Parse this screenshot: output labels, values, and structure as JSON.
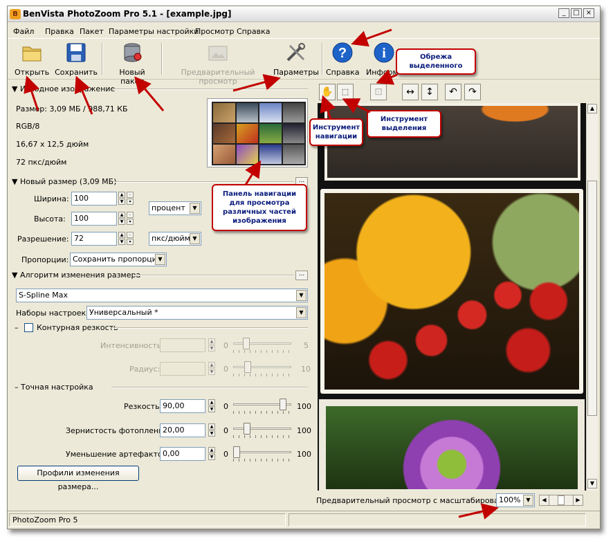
{
  "window": {
    "title": "BenVista PhotoZoom Pro 5.1 - [example.jpg]",
    "app_icon": "bz-logo-icon",
    "min": "_",
    "max": "□",
    "close": "×"
  },
  "menu": [
    "Файл",
    "Правка",
    "Пакет",
    "Параметры настройки",
    "Просмотр",
    "Справка"
  ],
  "toolbar": {
    "open": "Открыть",
    "save": "Сохранить",
    "batch": "Новый пакет",
    "preview": "Предварительный просмотр",
    "params": "Параметры",
    "help": "Справка",
    "info": "Информа"
  },
  "source": {
    "header": "Исходное изображение",
    "size": "Размер: 3,09 МБ / 988,71 КБ",
    "mode": "RGB/8",
    "dims": "16,67 x 12,5 дюйм",
    "dpi": "72 пкс/дюйм"
  },
  "newsize": {
    "header": "Новый размер (3,09 МБ)",
    "width_label": "Ширина:",
    "width": "100",
    "height_label": "Высота:",
    "height": "100",
    "unit": "процент",
    "res_label": "Разрешение:",
    "res": "72",
    "res_unit": "пкс/дюйм",
    "prop_label": "Пропорции:",
    "prop": "Сохранить пропорции"
  },
  "algo": {
    "header": "Алгоритм изменения размера",
    "method": "S-Spline Max",
    "presets_label": "Наборы настроек:",
    "preset": "Универсальный *"
  },
  "sharpen": {
    "header": "Контурная резкость",
    "intensity_label": "Интенсивность:",
    "intensity_min": "0",
    "intensity_max": "5",
    "radius_label": "Радиус:",
    "radius_min": "0",
    "radius_max": "10"
  },
  "fine": {
    "header": "Точная настройка",
    "sharp_label": "Резкость:",
    "sharp": "90,00",
    "sharp_level": 0.9,
    "grain_label": "Зернистость фотопленки:",
    "grain": "20,00",
    "grain_level": 0.2,
    "artifacts_label": "Уменьшение артефактов:",
    "artifacts": "0,00",
    "artifacts_level": 0.0,
    "min": "0",
    "max": "100"
  },
  "profiles_button": "Профили изменения размера...",
  "preview_zoom": {
    "label": "Предварительный просмотр с масштабированием:",
    "value": "100%"
  },
  "status": {
    "left": "PhotoZoom Pro 5"
  },
  "annotations": {
    "crop": "Обрежа выделенного",
    "nav_tool": "Инструмент навигации",
    "sel_tool": "Инструмент выделения",
    "nav_panel": "Панель навигации для просмотра различных частей изображения"
  },
  "colors": {
    "accent_arrow": "#c20000",
    "callout_text": "#0b1c7c"
  }
}
